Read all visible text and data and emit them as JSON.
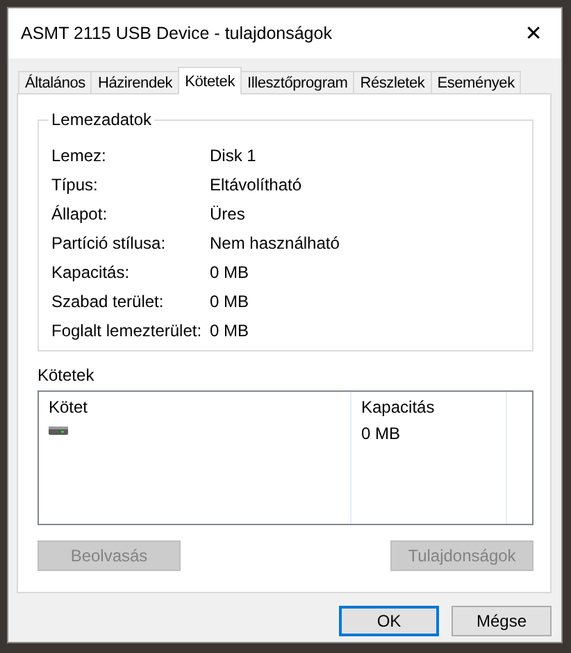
{
  "window": {
    "title": "ASMT 2115 USB Device - tulajdonságok",
    "close": "✕"
  },
  "tabs": [
    {
      "label": "Általános",
      "selected": false
    },
    {
      "label": "Házirendek",
      "selected": false
    },
    {
      "label": "Kötetek",
      "selected": true
    },
    {
      "label": "Illesztőprogram",
      "selected": false
    },
    {
      "label": "Részletek",
      "selected": false
    },
    {
      "label": "Események",
      "selected": false
    }
  ],
  "disk_info": {
    "title": "Lemezadatok",
    "rows": [
      {
        "label": "Lemez:",
        "value": "Disk 1"
      },
      {
        "label": "Típus:",
        "value": "Eltávolítható"
      },
      {
        "label": "Állapot:",
        "value": "Üres"
      },
      {
        "label": "Partíció stílusa:",
        "value": "Nem használható"
      },
      {
        "label": "Kapacitás:",
        "value": "0 MB"
      },
      {
        "label": "Szabad terület:",
        "value": "0 MB"
      },
      {
        "label": "Foglalt lemezterület:",
        "value": "0 MB"
      }
    ]
  },
  "volumes": {
    "title": "Kötetek",
    "columns": [
      "Kötet",
      "Kapacitás"
    ],
    "rows": [
      {
        "capacity": "0 MB"
      }
    ],
    "buttons": [
      {
        "label": "Beolvasás",
        "disabled": true
      },
      {
        "label": "Tulajdonságok",
        "disabled": true
      }
    ]
  },
  "dialog_buttons": [
    {
      "label": "OK",
      "default": true
    },
    {
      "label": "Mégse",
      "default": false
    }
  ]
}
